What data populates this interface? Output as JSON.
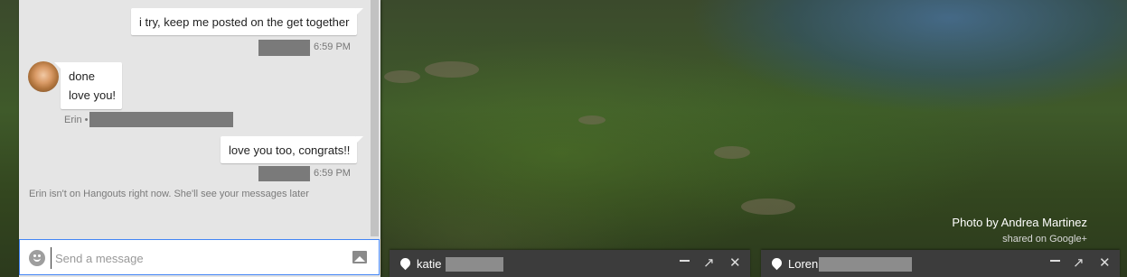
{
  "conversation": {
    "messages": [
      {
        "text": "i try, keep me posted on the get together",
        "time": "6:59 PM"
      },
      {
        "lines": [
          "done",
          "love you!"
        ],
        "sender_label": "Erin •"
      },
      {
        "text": "love you too, congrats!!",
        "time": "6:59 PM"
      }
    ],
    "status_note": "Erin isn't on Hangouts right now. She'll see your messages later"
  },
  "compose": {
    "placeholder": "Send a message"
  },
  "icons": {
    "emoji": "emoji-icon",
    "image": "image-icon",
    "tab_pin": "hangouts-pin-icon",
    "minimize": "minimize-icon",
    "popout": "popout-arrow-icon",
    "close": "close-icon"
  },
  "chat_tabs": [
    {
      "name": "katie",
      "minimize": "—",
      "popout": "↗",
      "close": "✕"
    },
    {
      "name": "Loren",
      "minimize": "—",
      "popout": "↗",
      "close": "✕"
    }
  ],
  "background": {
    "credit_line1": "Photo by Andrea Martinez",
    "credit_line2": "shared on Google+"
  },
  "colors": {
    "accent": "#4285f4",
    "chat_background": "#e5e5e5",
    "tab_background": "#3c3c3c"
  }
}
